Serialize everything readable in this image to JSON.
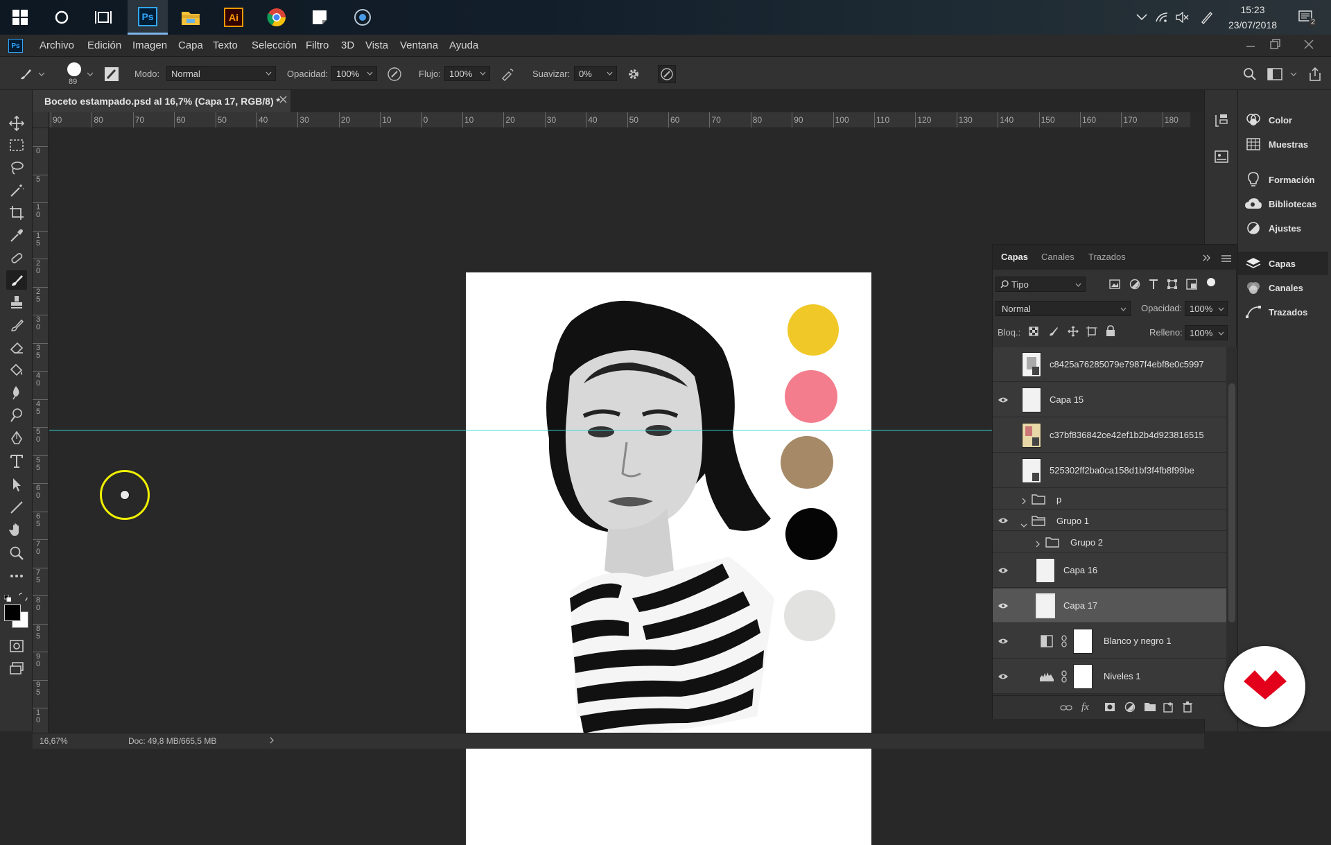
{
  "taskbar": {
    "time": "15:23",
    "date": "23/07/2018",
    "notifications": "2",
    "apps": [
      "windows-start",
      "cortana",
      "task-view",
      "photoshop",
      "file-explorer",
      "illustrator",
      "chrome",
      "sticky-notes",
      "media-app"
    ],
    "ps_label": "Ps",
    "ai_label": "Ai"
  },
  "menubar": {
    "app_icon": "Ps",
    "items": [
      "Archivo",
      "Edición",
      "Imagen",
      "Capa",
      "Texto",
      "Selección",
      "Filtro",
      "3D",
      "Vista",
      "Ventana",
      "Ayuda"
    ]
  },
  "options": {
    "brush_size": "89",
    "mode_label": "Modo:",
    "mode_value": "Normal",
    "opacity_label": "Opacidad:",
    "opacity_value": "100%",
    "flow_label": "Flujo:",
    "flow_value": "100%",
    "smooth_label": "Suavizar:",
    "smooth_value": "0%"
  },
  "document": {
    "tab_title": "Boceto estampado.psd al 16,7% (Capa 17, RGB/8) *",
    "zoom": "16,67%",
    "doc_info": "Doc: 49,8 MB/665,5 MB"
  },
  "rulers": {
    "h_ticks": [
      "90",
      "80",
      "70",
      "60",
      "50",
      "40",
      "30",
      "20",
      "10",
      "0",
      "10",
      "20",
      "30",
      "40",
      "50",
      "60",
      "70",
      "80",
      "90",
      "100",
      "110",
      "120",
      "130",
      "140",
      "150",
      "160",
      "170",
      "180"
    ],
    "v_ticks": [
      "0",
      "5",
      "1\n0",
      "1\n5",
      "2\n0",
      "2\n5",
      "3\n0",
      "3\n5",
      "4\n0",
      "4\n5",
      "5\n0",
      "5\n5",
      "6\n0",
      "6\n5",
      "7\n0",
      "7\n5",
      "8\n0",
      "8\n5",
      "9\n0",
      "9\n5",
      "1\n0"
    ]
  },
  "swatches": [
    "#f0c828",
    "#f37d8c",
    "#a68a68",
    "#050505",
    "#e2e2e0"
  ],
  "right_panels": [
    {
      "label": "Color",
      "icon": "color-icon"
    },
    {
      "label": "Muestras",
      "icon": "swatches-icon"
    },
    {
      "label": "Formación",
      "icon": "learn-icon"
    },
    {
      "label": "Bibliotecas",
      "icon": "libraries-icon"
    },
    {
      "label": "Ajustes",
      "icon": "adjustments-icon"
    },
    {
      "label": "Capas",
      "icon": "layers-icon"
    },
    {
      "label": "Canales",
      "icon": "channels-icon"
    },
    {
      "label": "Trazados",
      "icon": "paths-icon"
    }
  ],
  "layers_panel": {
    "tabs": [
      "Capas",
      "Canales",
      "Trazados"
    ],
    "filter_value": "Tipo",
    "blend_mode": "Normal",
    "opacity_label": "Opacidad:",
    "opacity_value": "100%",
    "lock_label": "Bloq.:",
    "fill_label": "Relleno:",
    "fill_value": "100%",
    "layers": [
      {
        "name": "c8425a76285079e7987f4ebf8e0c5997",
        "visible": false
      },
      {
        "name": "Capa 15",
        "visible": true
      },
      {
        "name": "c37bf836842ce42ef1b2b4d923816515",
        "visible": false
      },
      {
        "name": "525302ff2ba0ca158d1bf3f4fb8f99be",
        "visible": false
      },
      {
        "name": "p",
        "visible": false
      },
      {
        "name": "Grupo 1",
        "visible": true
      },
      {
        "name": "Grupo 2",
        "visible": false
      },
      {
        "name": "Capa 16",
        "visible": true
      },
      {
        "name": "Capa 17",
        "visible": true
      },
      {
        "name": "Blanco y negro 1",
        "visible": true
      },
      {
        "name": "Niveles 1",
        "visible": true
      }
    ]
  }
}
